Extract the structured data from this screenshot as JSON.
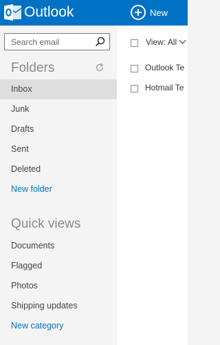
{
  "app": {
    "title": "Outlook"
  },
  "toolbar": {
    "new_label": "New"
  },
  "search": {
    "placeholder": "Search email"
  },
  "folders": {
    "heading": "Folders",
    "items": [
      {
        "label": "Inbox",
        "selected": true
      },
      {
        "label": "Junk"
      },
      {
        "label": "Drafts"
      },
      {
        "label": "Sent"
      },
      {
        "label": "Deleted"
      }
    ],
    "new_folder_label": "New folder"
  },
  "quick_views": {
    "heading": "Quick views",
    "items": [
      {
        "label": "Documents"
      },
      {
        "label": "Flagged"
      },
      {
        "label": "Photos"
      },
      {
        "label": "Shipping updates"
      }
    ],
    "new_category_label": "New category"
  },
  "message_list": {
    "view_label": "View: All",
    "messages": [
      {
        "sender": "Outlook Te"
      },
      {
        "sender": "Hotmail Te"
      }
    ]
  },
  "colors": {
    "brand": "#0072c6",
    "sidebar_bg": "#f4f4f4",
    "selected_bg": "#dedede",
    "link": "#0072c6"
  },
  "icons": [
    "outlook-logo-icon",
    "plus-circle-icon",
    "search-icon",
    "refresh-icon",
    "chevron-down-icon"
  ]
}
